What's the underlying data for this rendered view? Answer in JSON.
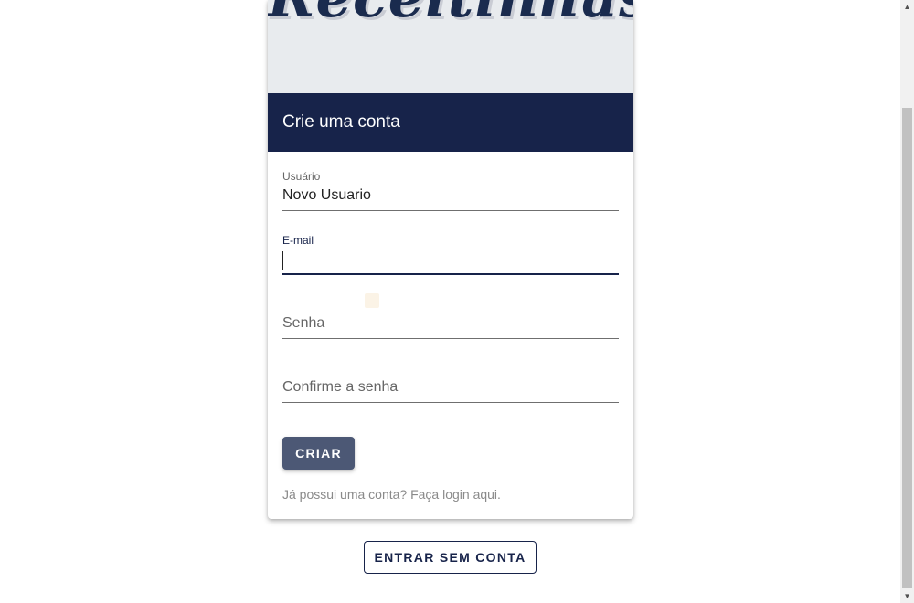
{
  "logo": {
    "text": "Receitinhas"
  },
  "form": {
    "title": "Crie uma conta",
    "username": {
      "label": "Usuário",
      "value": "Novo Usuario"
    },
    "email": {
      "label": "E-mail",
      "value": ""
    },
    "password": {
      "placeholder": "Senha"
    },
    "confirm_password": {
      "placeholder": "Confirme a senha"
    },
    "submit_label": "CRIAR",
    "login_link": "Já possui uma conta? Faça login aqui."
  },
  "guest_button_label": "ENTRAR SEM CONTA",
  "colors": {
    "header_bg": "#17234a",
    "button_bg": "#4c5875",
    "logo_bg": "#e8ebee"
  },
  "scrollbar": {
    "up_icon": "scroll-up-arrow",
    "down_icon": "scroll-down-arrow"
  }
}
